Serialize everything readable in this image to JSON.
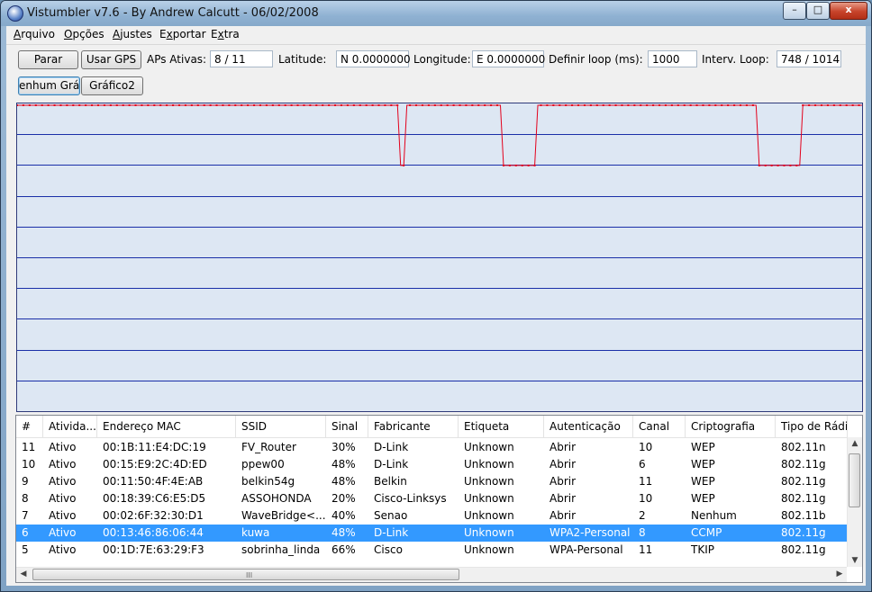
{
  "window": {
    "title": "Vistumbler v7.6 - By Andrew Calcutt - 06/02/2008",
    "minimize_label": "–",
    "maximize_label": "□",
    "close_label": "x"
  },
  "menu": [
    {
      "hot": "A",
      "rest": "rquivo"
    },
    {
      "hot": "O",
      "rest": "pções"
    },
    {
      "hot": "A",
      "rest": "justes"
    },
    {
      "pre": "E",
      "hot": "x",
      "rest": "portar"
    },
    {
      "pre": "E",
      "hot": "x",
      "rest": "tra"
    }
  ],
  "toolbar": {
    "stop_label": "Parar",
    "gps_label": "Usar GPS",
    "active_aps_label": "APs Ativas:",
    "active_aps_value": "8 / 11",
    "latitude_label": "Latitude:",
    "latitude_value": "N 0.0000000",
    "longitude_label": "Longitude:",
    "longitude_value": "E 0.0000000",
    "loop_label": "Definir loop (ms):",
    "loop_value": "1000",
    "interval_label": "Interv. Loop:",
    "interval_value": "748 / 1014",
    "no_graph_label": "enhum Gráfic",
    "graph2_label": "Gráfico2"
  },
  "graph": {
    "signal_samples": [
      100,
      100,
      100,
      100,
      100,
      100,
      100,
      100,
      100,
      100,
      100,
      100,
      100,
      100,
      100,
      100,
      100,
      100,
      100,
      100,
      100,
      100,
      100,
      100,
      100,
      100,
      100,
      100,
      100,
      100,
      100,
      100,
      100,
      100,
      100,
      100,
      100,
      100,
      100,
      100,
      100,
      100,
      100,
      100,
      100,
      100,
      100,
      100,
      100,
      100,
      100,
      100,
      100,
      100,
      100,
      100,
      100,
      100,
      100,
      100,
      100,
      100,
      100,
      100,
      100,
      100,
      100,
      100,
      100,
      100,
      100,
      100,
      100,
      100,
      100,
      100,
      100,
      100,
      100,
      100,
      100,
      100,
      100,
      100,
      100,
      100,
      100,
      100,
      100,
      100,
      100,
      100,
      100,
      100,
      100,
      100,
      100,
      100,
      100,
      100,
      100,
      100,
      100,
      100,
      100,
      100,
      100,
      100,
      100,
      100,
      100,
      100,
      100,
      100,
      100,
      100,
      100,
      100,
      100,
      100,
      100,
      100,
      100,
      80,
      80,
      100,
      100,
      100,
      100,
      100,
      100,
      100,
      100,
      100,
      100,
      100,
      100,
      100,
      100,
      100,
      100,
      100,
      100,
      100,
      100,
      100,
      100,
      100,
      100,
      100,
      100,
      100,
      100,
      100,
      100,
      100,
      80,
      80,
      80,
      80,
      80,
      80,
      80,
      80,
      80,
      80,
      80,
      100,
      100,
      100,
      100,
      100,
      100,
      100,
      100,
      100,
      100,
      100,
      100,
      100,
      100,
      100,
      100,
      100,
      100,
      100,
      100,
      100,
      100,
      100,
      100,
      100,
      100,
      100,
      100,
      100,
      100,
      100,
      100,
      100,
      100,
      100,
      100,
      100,
      100,
      100,
      100,
      100,
      100,
      100,
      100,
      100,
      100,
      100,
      100,
      100,
      100,
      100,
      100,
      100,
      100,
      100,
      100,
      100,
      100,
      100,
      100,
      100,
      100,
      100,
      100,
      100,
      100,
      100,
      100,
      100,
      100,
      100,
      80,
      80,
      80,
      80,
      80,
      80,
      80,
      80,
      80,
      80,
      80,
      80,
      80,
      80,
      100,
      100,
      100,
      100,
      100,
      100,
      100,
      100,
      100,
      100,
      100,
      100,
      100,
      100,
      100,
      100,
      100,
      100,
      100,
      100
    ],
    "y_max": 100,
    "gridlines": 10,
    "line_color": "#e3001b",
    "grid_color": "#1a2fa8",
    "background": "#dde7f3"
  },
  "list": {
    "columns": [
      "#",
      "Atividade",
      "Endereço MAC",
      "SSID",
      "Sinal",
      "Fabricante",
      "Etiqueta",
      "Autenticação",
      "Canal",
      "Criptografia",
      "Tipo de Rádio"
    ],
    "column_display": [
      "#",
      "Ativida...",
      "Endereço MAC",
      "SSID",
      "Sinal",
      "Fabricante",
      "Etiqueta",
      "Autenticação",
      "Canal",
      "Criptografia",
      "Tipo de Rádi"
    ],
    "rows": [
      [
        "11",
        "Ativo",
        "00:1B:11:E4:DC:19",
        "FV_Router",
        "30%",
        "D-Link",
        "Unknown",
        "Abrir",
        "10",
        "WEP",
        "802.11n"
      ],
      [
        "10",
        "Ativo",
        "00:15:E9:2C:4D:ED",
        "ppew00",
        "48%",
        "D-Link",
        "Unknown",
        "Abrir",
        "6",
        "WEP",
        "802.11g"
      ],
      [
        "9",
        "Ativo",
        "00:11:50:4F:4E:AB",
        "belkin54g",
        "48%",
        "Belkin",
        "Unknown",
        "Abrir",
        "11",
        "WEP",
        "802.11g"
      ],
      [
        "8",
        "Ativo",
        "00:18:39:C6:E5:D5",
        "ASSOHONDA",
        "20%",
        "Cisco-Linksys",
        "Unknown",
        "Abrir",
        "10",
        "WEP",
        "802.11g"
      ],
      [
        "7",
        "Ativo",
        "00:02:6F:32:30:D1",
        "WaveBridge<...",
        "40%",
        "Senao",
        "Unknown",
        "Abrir",
        "2",
        "Nenhum",
        "802.11b"
      ],
      [
        "6",
        "Ativo",
        "00:13:46:86:06:44",
        "kuwa",
        "48%",
        "D-Link",
        "Unknown",
        "WPA2-Personal",
        "8",
        "CCMP",
        "802.11g"
      ],
      [
        "5",
        "Ativo",
        "00:1D:7E:63:29:F3",
        "sobrinha_linda",
        "66%",
        "Cisco",
        "Unknown",
        "WPA-Personal",
        "11",
        "TKIP",
        "802.11g"
      ]
    ],
    "selected_row": 5,
    "scroll_grip": "III"
  }
}
